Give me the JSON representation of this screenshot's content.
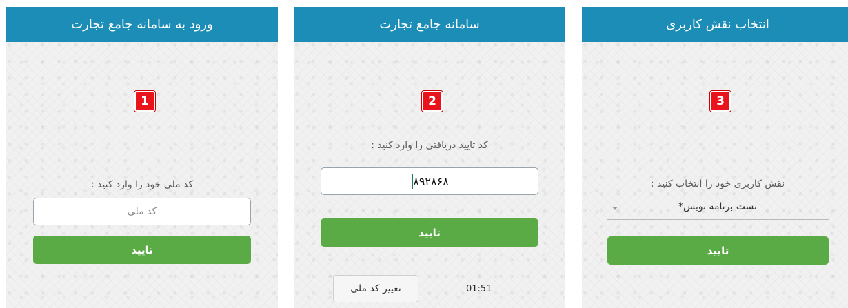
{
  "screens": [
    {
      "header_title": "ورود به سامانه جامع تجارت",
      "step_badge": "1",
      "prompt": "کد ملی خود را وارد کنید :",
      "input_placeholder": "کد ملی",
      "confirm_label": "تایید"
    },
    {
      "header_title": "سامانه جامع تجارت",
      "step_badge": "2",
      "prompt": "کد تایید دریافتی را وارد کنید :",
      "input_value": "۸۹۲۸۶۸",
      "confirm_label": "تایید",
      "change_id_label": "تغییر کد ملی",
      "timer": "01:51"
    },
    {
      "header_title": "انتخاب نقش کاربری",
      "step_badge": "3",
      "prompt": "نقش کاربری خود را انتخاب کنید :",
      "role_selected": "تست برنامه نویس*",
      "dropdown_icon": "chevron-down-icon",
      "confirm_label": "تایید"
    }
  ],
  "colors": {
    "header": "#1c8db7",
    "confirm": "#5aab45",
    "badge": "#e8131b"
  }
}
